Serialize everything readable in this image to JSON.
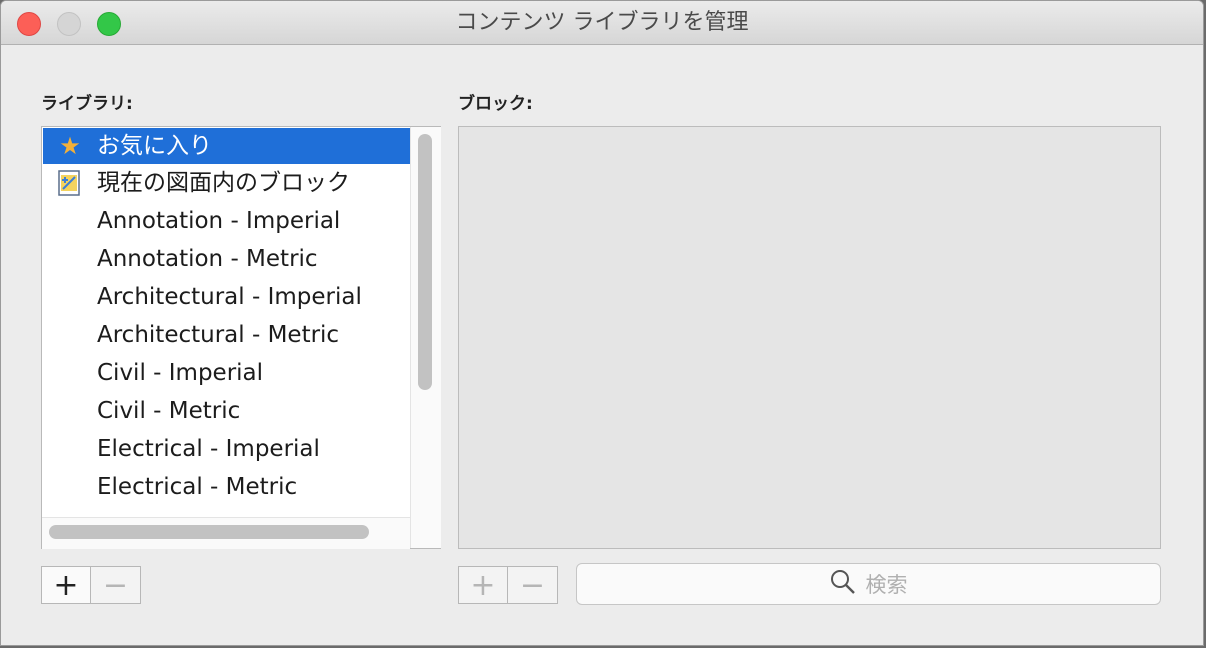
{
  "window": {
    "title": "コンテンツ ライブラリを管理"
  },
  "library": {
    "label": "ライブラリ:",
    "items": [
      {
        "label": "お気に入り",
        "icon": "star-icon",
        "selected": true
      },
      {
        "label": "現在の図面内のブロック",
        "icon": "drawing-file-icon",
        "selected": false
      },
      {
        "label": "Annotation - Imperial"
      },
      {
        "label": "Annotation - Metric"
      },
      {
        "label": "Architectural - Imperial"
      },
      {
        "label": "Architectural - Metric"
      },
      {
        "label": "Civil - Imperial"
      },
      {
        "label": "Civil - Metric"
      },
      {
        "label": "Electrical - Imperial"
      },
      {
        "label": "Electrical - Metric"
      }
    ],
    "add_label": "+",
    "remove_label": "−"
  },
  "blocks": {
    "label": "ブロック:",
    "add_label": "+",
    "remove_label": "−"
  },
  "search": {
    "placeholder": "検索"
  },
  "colors": {
    "selection": "#1f6fd8",
    "star": "#f2b03a",
    "close": "#fc5f57",
    "maximize": "#33c748"
  }
}
